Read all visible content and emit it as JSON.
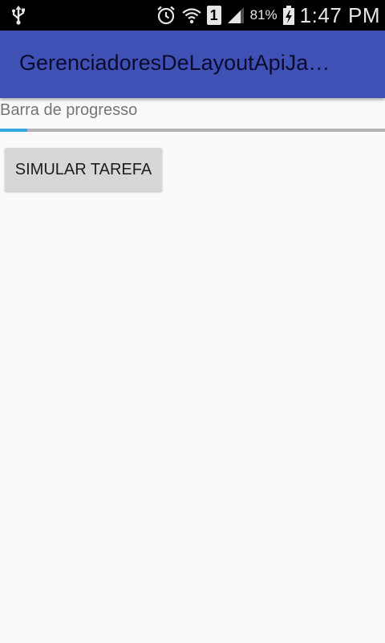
{
  "status_bar": {
    "left_icons": [
      "usb-icon"
    ],
    "right_icons": [
      "alarm-icon",
      "wifi-icon",
      "sim-icon",
      "signal-icon",
      "battery-charging-icon"
    ],
    "sim_slot": "1",
    "battery_percent": "81%",
    "time": "1:47 PM"
  },
  "app_bar": {
    "title": "GerenciadoresDeLayoutApiJa…",
    "background_color": "#3f51b5"
  },
  "main": {
    "progress_label": "Barra de progresso",
    "progress_value": 0.07,
    "progress_color": "#35a7df",
    "button_label": "SIMULAR TAREFA"
  }
}
